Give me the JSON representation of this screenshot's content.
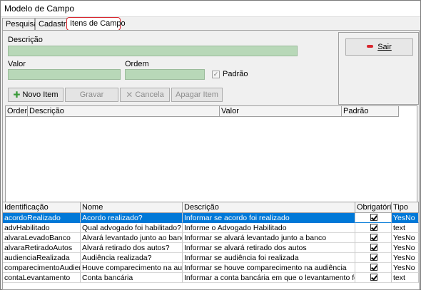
{
  "window": {
    "title": "Modelo de Campo"
  },
  "tabs": [
    {
      "label": "Pesquisa"
    },
    {
      "label": "Cadastro"
    },
    {
      "label": "Itens de Campo"
    }
  ],
  "form": {
    "descricao_label": "Descrição",
    "valor_label": "Valor",
    "ordem_label": "Ordem",
    "padrao_label": "Padrão",
    "descricao_value": "",
    "valor_value": "",
    "ordem_value": "",
    "padrao_checked": true
  },
  "toolbar": {
    "novo_item": "Novo Item",
    "gravar": "Gravar",
    "cancela": "Cancela",
    "apagar_item": "Apagar Item"
  },
  "sair": {
    "label": "Sair"
  },
  "items_grid": {
    "columns": [
      "Ordem",
      "Descrição",
      "Valor",
      "Padrão"
    ]
  },
  "fields_grid": {
    "columns": [
      "Identificação",
      "Nome",
      "Descrição",
      "Obrigatório",
      "Tipo"
    ],
    "rows": [
      {
        "id": "acordoRealizado",
        "nome": "Acordo realizado?",
        "descricao": "Informar se acordo foi realizado",
        "obrigatorio": true,
        "tipo": "YesNo",
        "selected": true
      },
      {
        "id": "advHabilitado",
        "nome": "Qual advogado foi habilitado?",
        "descricao": "Informe o Advogado Habilitado",
        "obrigatorio": true,
        "tipo": "text",
        "selected": false
      },
      {
        "id": "alvaraLevadoBanco",
        "nome": "Alvará levantado junto ao banco?",
        "descricao": "Informar se alvará levantado junto a banco",
        "obrigatorio": true,
        "tipo": "YesNo",
        "selected": false
      },
      {
        "id": "alvaraRetiradoAutos",
        "nome": "Alvará retirado dos autos?",
        "descricao": "Informar se alvará retirado dos autos",
        "obrigatorio": true,
        "tipo": "YesNo",
        "selected": false
      },
      {
        "id": "audienciaRealizada",
        "nome": "Audiência realizada?",
        "descricao": "Informar se audiência foi realizada",
        "obrigatorio": true,
        "tipo": "YesNo",
        "selected": false
      },
      {
        "id": "comparecimentoAudiencia",
        "nome": "Houve comparecimento na audiência?",
        "descricao": "Informar se houve comparecimento na audiência",
        "obrigatorio": true,
        "tipo": "YesNo",
        "selected": false
      },
      {
        "id": "contaLevantamento",
        "nome": "Conta bancária",
        "descricao": "Informar a conta bancária em que o levantamento foi realizado",
        "obrigatorio": true,
        "tipo": "text",
        "selected": false
      }
    ]
  }
}
